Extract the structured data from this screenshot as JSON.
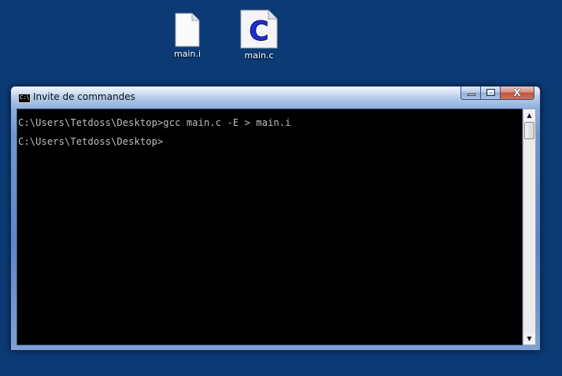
{
  "desktop": {
    "icons": [
      {
        "label": "main.i",
        "icon": "blank-file-icon"
      },
      {
        "label": "main.c",
        "icon": "c-source-file-icon",
        "glyph": "C"
      }
    ]
  },
  "window": {
    "title": "Invite de commandes",
    "app_icon_text": "C:\\",
    "close_glyph": "X"
  },
  "console": {
    "lines": [
      "C:\\Users\\Tetdoss\\Desktop>gcc main.c -E > main.i",
      "C:\\Users\\Tetdoss\\Desktop>"
    ]
  },
  "scrollbar": {
    "up_glyph": "▲",
    "down_glyph": "▼"
  },
  "colors": {
    "desktop_background": "#0b3a75",
    "console_background": "#000000",
    "console_text": "#c0c0c0",
    "close_button": "#c2533b"
  }
}
